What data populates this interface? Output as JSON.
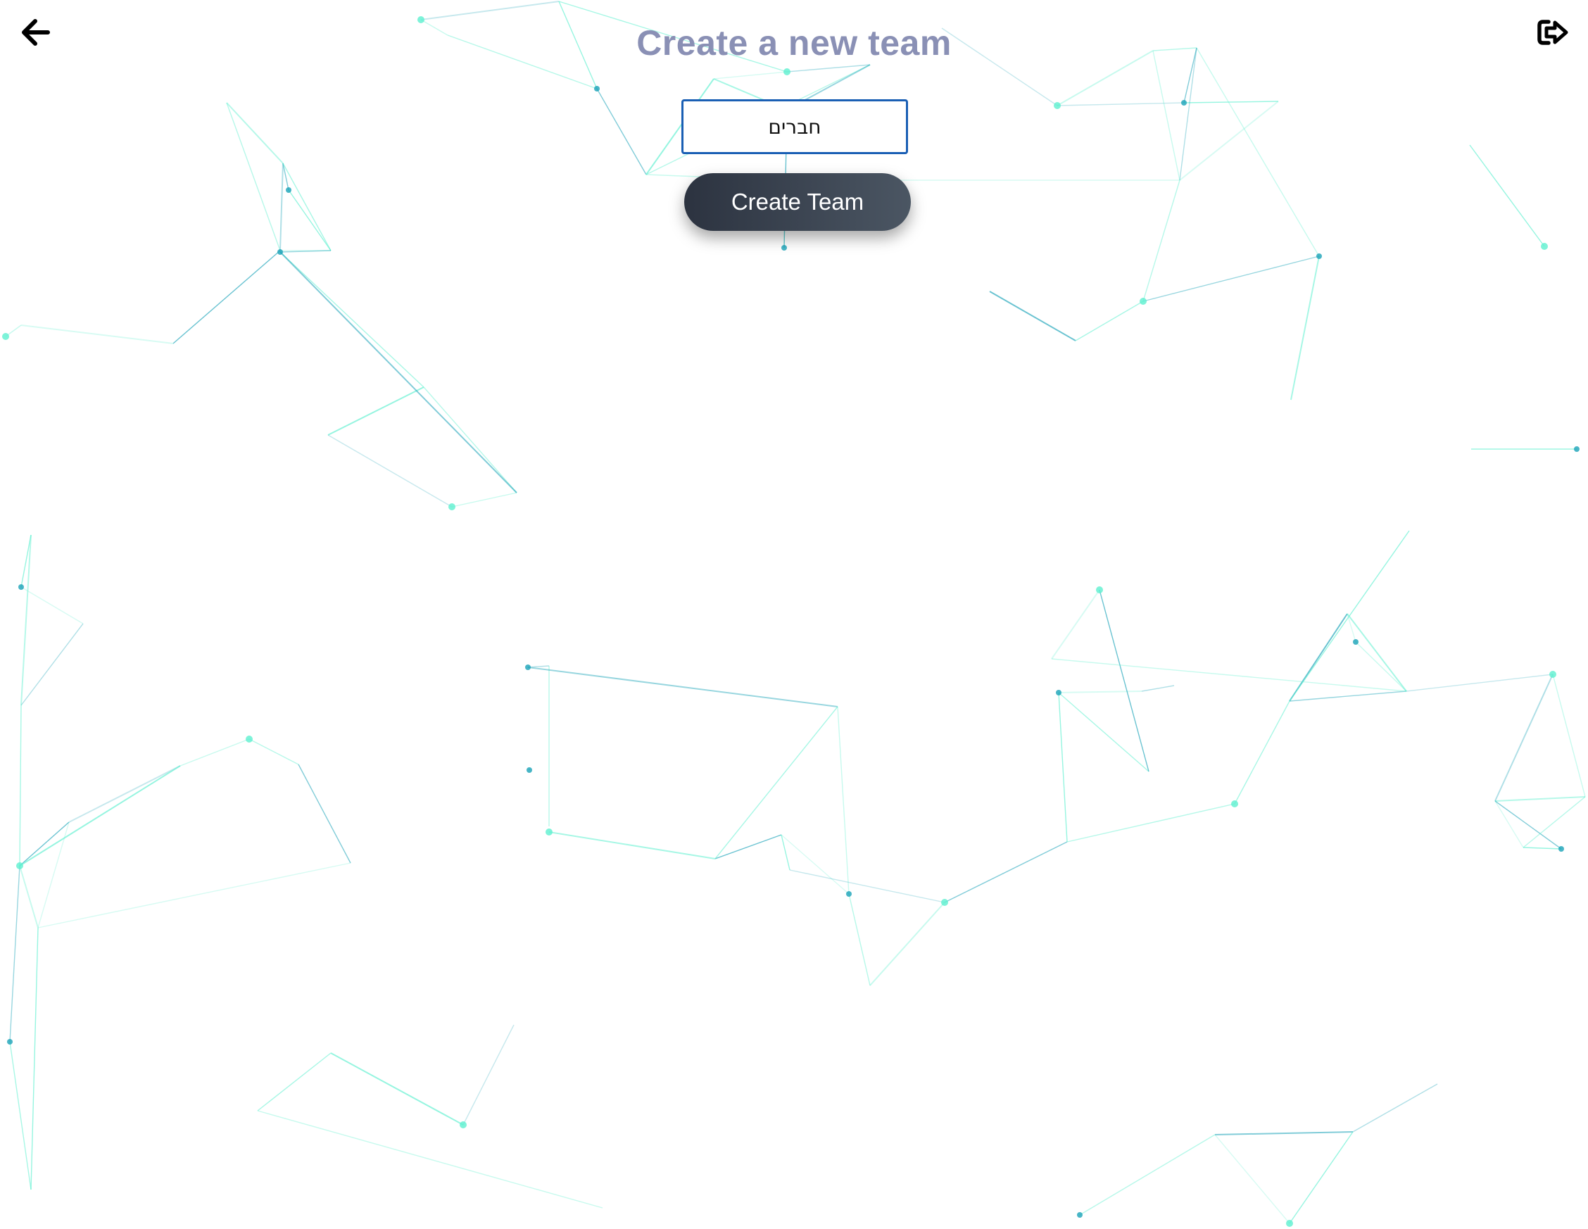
{
  "header": {
    "title": "Create a new team",
    "back_icon": "arrow-left-icon",
    "logout_icon": "sign-out-icon"
  },
  "form": {
    "team_name_value": "חברים",
    "submit_label": "Create Team"
  },
  "colors": {
    "title": "#8a90b5",
    "input_border": "#1a5fb4",
    "button_dark": "#2c3340",
    "button_light": "#4b5663",
    "network_teal": "#1aa3b8",
    "network_mint": "#5ef0cf"
  }
}
